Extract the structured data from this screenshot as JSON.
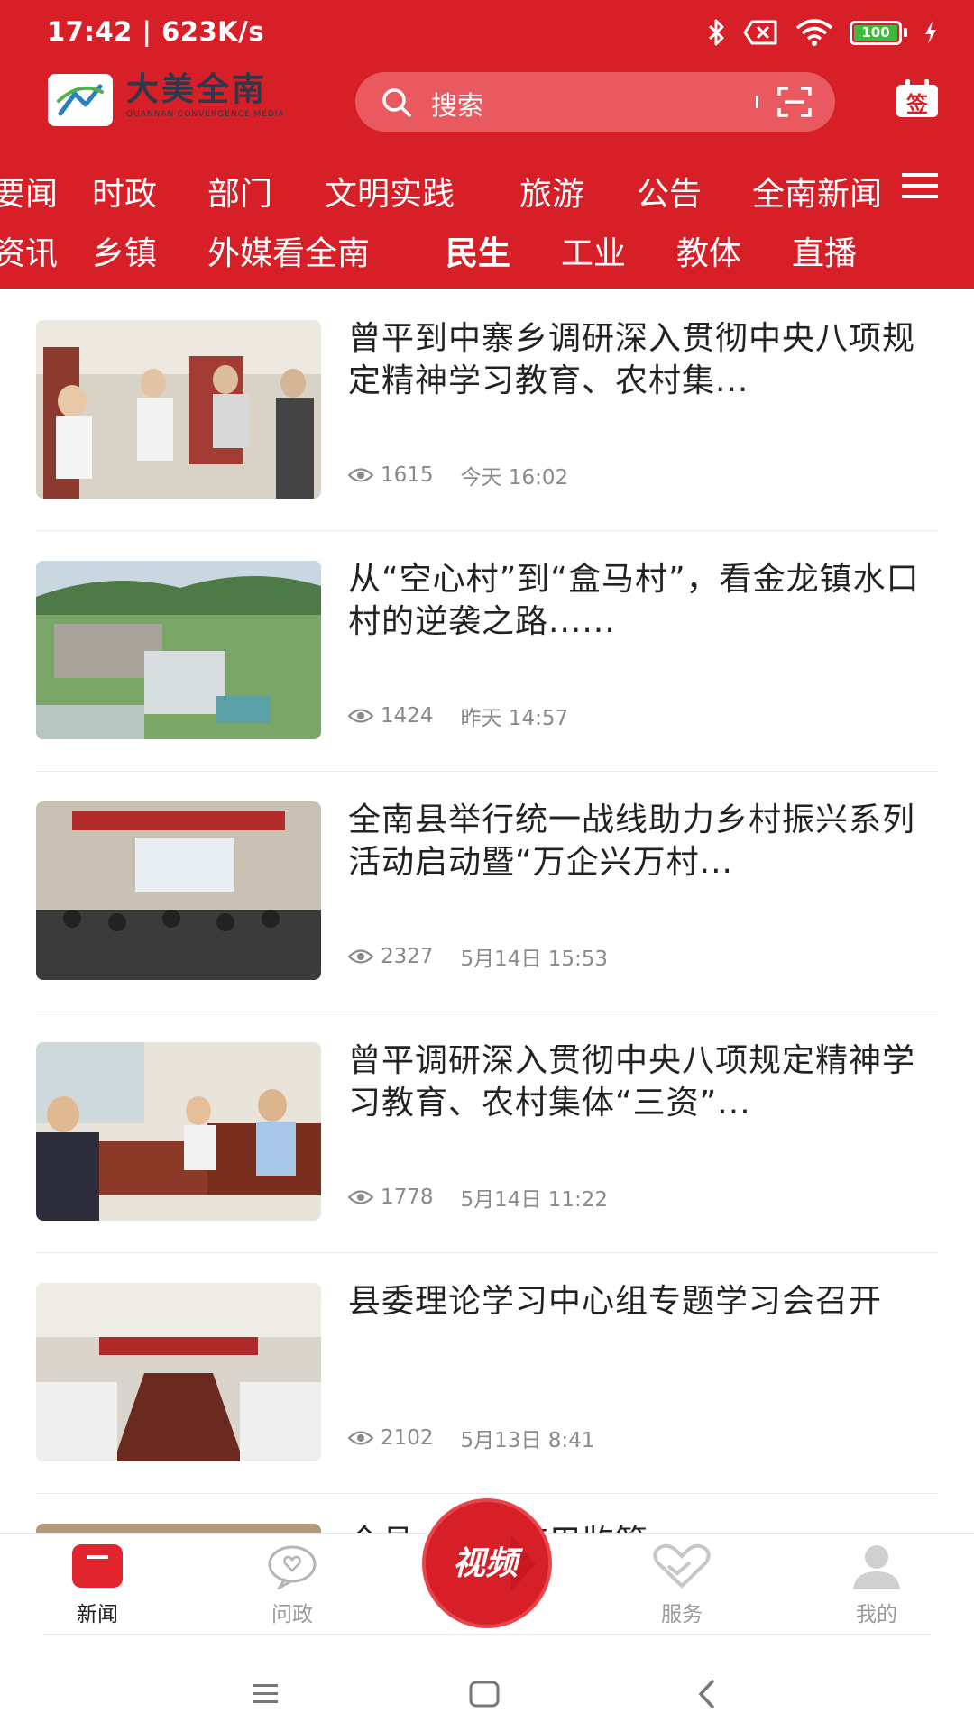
{
  "status_bar": {
    "time": "17:42 | 623K/s",
    "battery": "100"
  },
  "header": {
    "logo_cn": "大美全南",
    "logo_en": "QUANNAN CONVERGENCE MEDIA",
    "search_placeholder": "搜索",
    "sign_label": "签"
  },
  "tabs_row1": [
    "要闻",
    "时政",
    "部门",
    "文明实践",
    "旅游",
    "公告",
    "全南新闻"
  ],
  "tabs_row2": [
    "资讯",
    "乡镇",
    "外媒看全南",
    "民生",
    "工业",
    "教体",
    "直播"
  ],
  "active_tab": "民生",
  "news": [
    {
      "title": "曾平到中寨乡调研深入贯彻中央八项规定精神学习教育、农村集...",
      "views": "1615",
      "time": "今天 16:02"
    },
    {
      "title": "从“空心村”到“盒马村”，看金龙镇水口村的逆袭之路......",
      "views": "1424",
      "time": "昨天 14:57"
    },
    {
      "title": "全南县举行统一战线助力乡村振兴系列活动启动暨“万企兴万村...",
      "views": "2327",
      "time": "5月14日 15:53"
    },
    {
      "title": "曾平调研深入贯彻中央八项规定精神学习教育、农村集体“三资”...",
      "views": "1778",
      "time": "5月14日 11:22"
    },
    {
      "title": "县委理论学习中心组专题学习会召开",
      "views": "2102",
      "time": "5月13日 8:41"
    },
    {
      "title": "全县…资金使用监管…",
      "views": "",
      "time": ""
    }
  ],
  "bottom_nav": {
    "news": "新闻",
    "ask": "问政",
    "video": "视频",
    "service": "服务",
    "mine": "我的"
  },
  "colors": {
    "brand_red": "#d61f27",
    "search_bg": "#e85a5f",
    "meta_gray": "#8a8a8a"
  }
}
